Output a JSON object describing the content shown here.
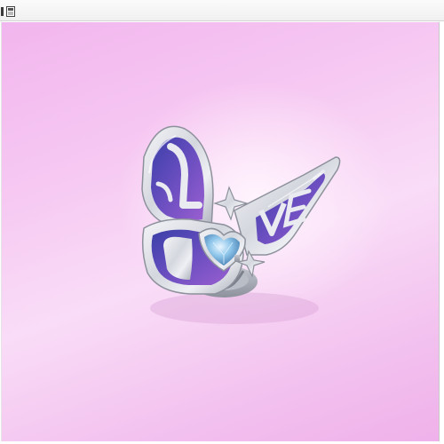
{
  "toolbar": {
    "buttons": [
      {
        "name": "toolbar-button",
        "icon": "bar-icon"
      },
      {
        "name": "toolbar-button",
        "icon": "panel-icon"
      }
    ]
  },
  "viewport": {
    "content": "3d-render",
    "object": "butterfly-ring",
    "gem": "heart-gem",
    "colors": {
      "background_top": "#f2b6ee",
      "background_center": "#fff4fd",
      "metal": "#d9dce3",
      "enamel_blue": "#3a3fa8",
      "enamel_purple": "#9a5fd0",
      "gem": "#8fc6ea"
    }
  }
}
